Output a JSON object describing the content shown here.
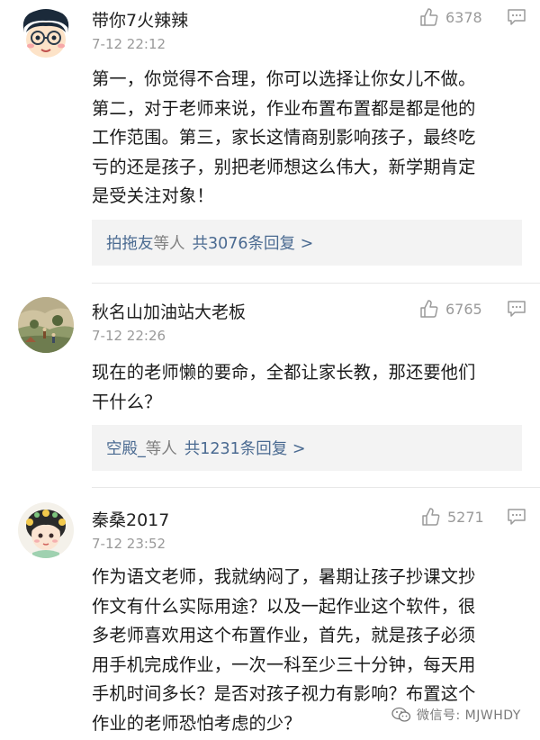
{
  "comments": [
    {
      "username": "带你7火辣辣",
      "timestamp": "7-12 22:12",
      "likes": "6378",
      "avatar_icon": "cartoon-boy-glasses-icon",
      "text_lines": [
        "第一，你觉得不合理，你可以选择让你女儿不做。",
        "第二，对于老师来说，作业布置布置都是都是他的",
        "工作范围。第三，家长这情商别影响孩子，最终吃",
        "亏的还是孩子，别把老师想这么伟大，新学期肯定",
        "是受关注对象！"
      ],
      "replies": {
        "names": "拍拖友",
        "others": "等人",
        "count": "共3076条回复 >"
      }
    },
    {
      "username": "秋名山加油站大老板",
      "timestamp": "7-12 22:26",
      "likes": "6765",
      "avatar_icon": "landscape-painting-icon",
      "text_lines": [
        "现在的老师懒的要命，全都让家长教，那还要他们",
        "干什么？"
      ],
      "replies": {
        "names": "空殿_",
        "others": "等人",
        "count": "共1231条回复 >"
      }
    },
    {
      "username": "秦桑2017",
      "timestamp": "7-12 23:52",
      "likes": "5271",
      "avatar_icon": "cartoon-girl-flowers-icon",
      "text_lines": [
        "作为语文老师，我就纳闷了，暑期让孩子抄课文抄",
        "作文有什么实际用途？以及一起作业这个软件，很",
        "多老师喜欢用这个布置作业，首先，就是孩子必须",
        "用手机完成作业，一次一科至少三十分钟，每天用",
        "手机时间多长？是否对孩子视力有影响？布置这个",
        "作业的老师恐怕考虑的少？"
      ]
    }
  ],
  "watermark": {
    "text": "微信号: MJWHDY",
    "icon": "wechat-icon"
  },
  "colors": {
    "link": "#4a6a91",
    "meta": "#9a9a9a",
    "text": "#1a1a1a",
    "reply_bg": "#f3f3f3"
  }
}
